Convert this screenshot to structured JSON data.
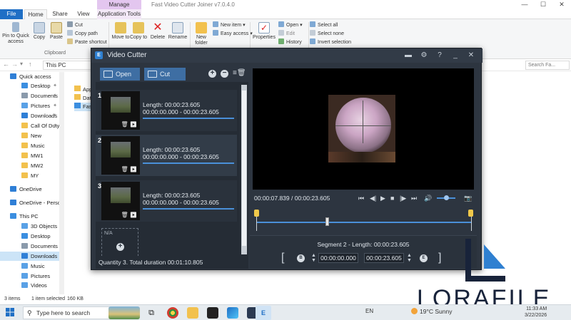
{
  "explorer": {
    "manage_label": "Manage",
    "app_name": "Fast Video Cutter Joiner v7.0.4.0",
    "tabs": [
      "File",
      "Home",
      "Share",
      "View",
      "Application Tools"
    ],
    "ribbon": {
      "pin_label": "Pin to Quick access",
      "copy_label": "Copy",
      "paste_label": "Paste",
      "cut_label": "Cut",
      "copy_path_label": "Copy path",
      "paste_shortcut_label": "Paste shortcut",
      "clipboard_group": "Clipboard",
      "move_to_label": "Move to",
      "copy_to_label": "Copy to",
      "delete_label": "Delete",
      "rename_label": "Rename",
      "new_folder_label": "New folder",
      "new_item_label": "New item",
      "easy_access_label": "Easy access",
      "properties_label": "Properties",
      "open_label": "Open",
      "edit_label": "Edit",
      "history_label": "History",
      "select_all_label": "Select all",
      "select_none_label": "Select none",
      "invert_selection_label": "Invert selection"
    },
    "address": "This PC",
    "search_placeholder": "Search Fa...",
    "nav": [
      {
        "label": "Quick access",
        "color": "#2f7fd6"
      },
      {
        "label": "Desktop",
        "color": "#3b8ee0"
      },
      {
        "label": "Documents",
        "color": "#8a9aab"
      },
      {
        "label": "Pictures",
        "color": "#5aa1e6"
      },
      {
        "label": "Downloads",
        "color": "#2f7fd6"
      },
      {
        "label": "Call Of Duty I",
        "color": "#f2c14e"
      },
      {
        "label": "New",
        "color": "#f2c14e"
      },
      {
        "label": "Music",
        "color": "#f2c14e"
      },
      {
        "label": "MW1",
        "color": "#f2c14e"
      },
      {
        "label": "MW2",
        "color": "#f2c14e"
      },
      {
        "label": "MY",
        "color": "#f2c14e"
      },
      {
        "label": "OneDrive",
        "color": "#2f7fd6"
      },
      {
        "label": "OneDrive - Person",
        "color": "#2f7fd6"
      },
      {
        "label": "This PC",
        "color": "#3b8ee0"
      },
      {
        "label": "3D Objects",
        "color": "#5aa1e6"
      },
      {
        "label": "Desktop",
        "color": "#3b8ee0"
      },
      {
        "label": "Documents",
        "color": "#8a9aab"
      },
      {
        "label": "Downloads",
        "color": "#2f7fd6"
      },
      {
        "label": "Music",
        "color": "#5aa1e6"
      },
      {
        "label": "Pictures",
        "color": "#5aa1e6"
      },
      {
        "label": "Videos",
        "color": "#5aa1e6"
      }
    ],
    "files": [
      "App",
      "Dat",
      "Fast"
    ],
    "status": {
      "items": "3 items",
      "selected": "1 item selected",
      "size": "160 KB"
    }
  },
  "cutter": {
    "title": "Video Cutter",
    "open_label": "Open",
    "cut_label": "Cut",
    "clips": [
      {
        "num": "1",
        "length": "Length: 00:00:23.605",
        "range": "00:00:00.000  -  00:00:23.605"
      },
      {
        "num": "2",
        "length": "Length: 00:00:23.605",
        "range": "00:00:00.000  -  00:00:23.605"
      },
      {
        "num": "3",
        "length": "Length: 00:00:23.605",
        "range": "00:00:00.000  -  00:00:23.605"
      }
    ],
    "na_label": "N/A",
    "summary": "Quantity 3. Total duration 00:01:10.805",
    "time_display": "00:00:07.839 / 00:00:23.605",
    "segment_label": "Segment 2 - Length: 00:00:23.605",
    "segment_start": "00:00:00.000",
    "segment_end": "00:00:23.605",
    "begin_marker": "B",
    "end_marker": "E"
  },
  "watermark": {
    "text": "LORAFILE"
  },
  "taskbar": {
    "search_placeholder": "Type here to search",
    "language": "EN",
    "weather": "19°C  Sunny",
    "time": "11:33 AM",
    "date": "3/22/2026"
  }
}
